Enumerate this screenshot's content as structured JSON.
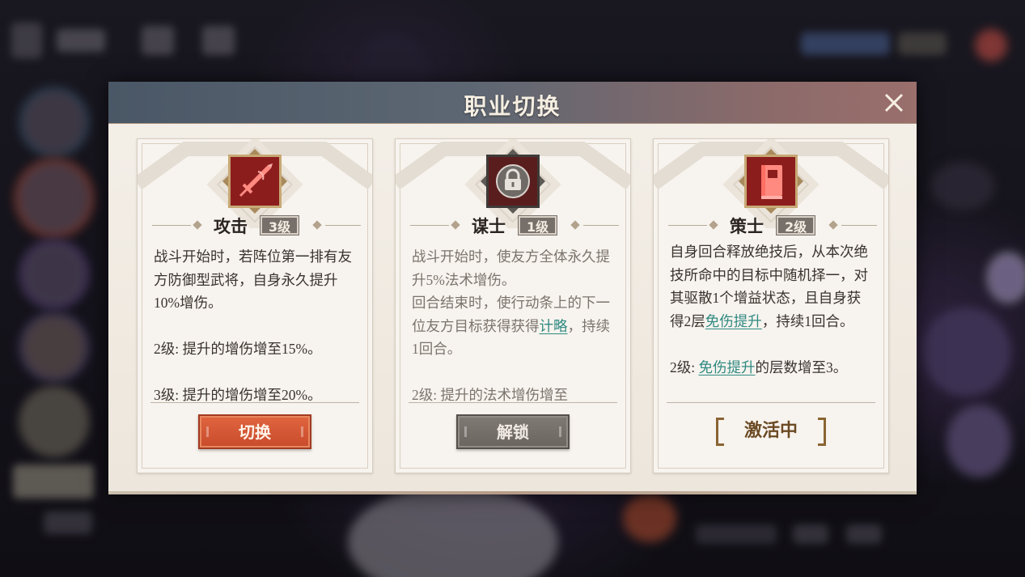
{
  "dialog": {
    "title": "职业切换",
    "close_icon": "close-icon"
  },
  "cards": [
    {
      "id": "attack",
      "name": "攻击",
      "level": "3级",
      "icon": "sword-icon",
      "icon_bg": "#8c1d1d",
      "description": [
        "战斗开始时，若阵位第一排有友方防御型武将，自身永久提升10%增伤。",
        "",
        "2级: 提升的增伤增至15%。",
        "",
        "3级: 提升的增伤增至20%。"
      ],
      "button": {
        "label": "切换",
        "state": "switch"
      }
    },
    {
      "id": "strategist",
      "name": "谋士",
      "level": "1级",
      "icon": "lock-icon",
      "icon_bg": "#5a1d1d",
      "desc_parts": {
        "line1": "战斗开始时，使友方全体永久提升5%法术增伤。",
        "line2_pre": "回合结束时，使行动条上的下一位友方目标获得获得",
        "line2_link": "计略",
        "line2_post": "，持续1回合。",
        "line3": "2级: 提升的法术增伤增至"
      },
      "button": {
        "label": "解锁",
        "state": "unlock"
      }
    },
    {
      "id": "tactician",
      "name": "策士",
      "level": "2级",
      "icon": "book-icon",
      "icon_bg": "#8c1d1d",
      "desc_parts": {
        "line1_pre": "自身回合释放绝技后，从本次绝技所命中的目标中随机择一，对其驱散1个增益状态，且自身获得2层",
        "line1_link": "免伤提升",
        "line1_post": "，持续1回合。",
        "line2_pre": "2级: ",
        "line2_link": "免伤提升",
        "line2_post": "的层数增至3。"
      },
      "button": {
        "label": "激活中",
        "state": "active"
      }
    }
  ],
  "colors": {
    "accent_orange": "#d25a35",
    "link_teal": "#2f8a82",
    "icon_red": "#8c1d1d",
    "header_slate": "#4a5766"
  }
}
